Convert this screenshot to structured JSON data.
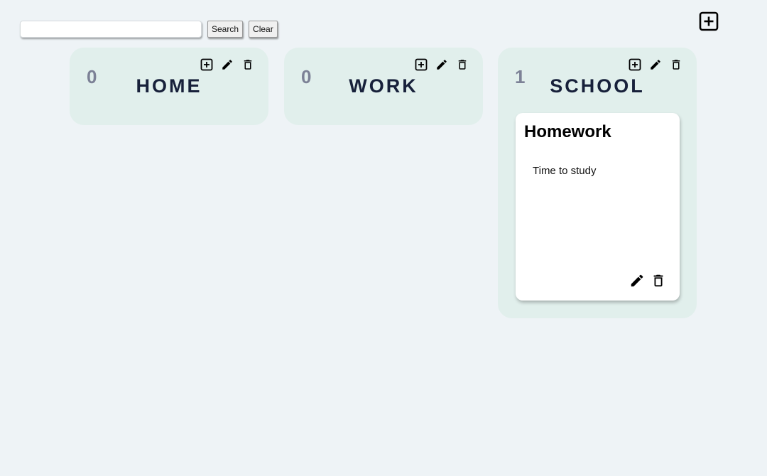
{
  "toolbar": {
    "search_value": "",
    "search_placeholder": "",
    "search_label": "Search",
    "clear_label": "Clear"
  },
  "add_board_icon": "add-box-icon",
  "boards": [
    {
      "count": "0",
      "title": "HOME",
      "cards": []
    },
    {
      "count": "0",
      "title": "WORK",
      "cards": []
    },
    {
      "count": "1",
      "title": "SCHOOL",
      "cards": [
        {
          "title": "Homework",
          "body": "Time to study"
        }
      ]
    }
  ],
  "icons": {
    "add": "add-box-icon",
    "edit": "pencil-icon",
    "delete": "trash-icon"
  },
  "colors": {
    "page_background": "#eef3f6",
    "board_background": "#e1efec",
    "board_title": "#17203a",
    "board_count": "#7c8196",
    "card_background": "#ffffff"
  }
}
